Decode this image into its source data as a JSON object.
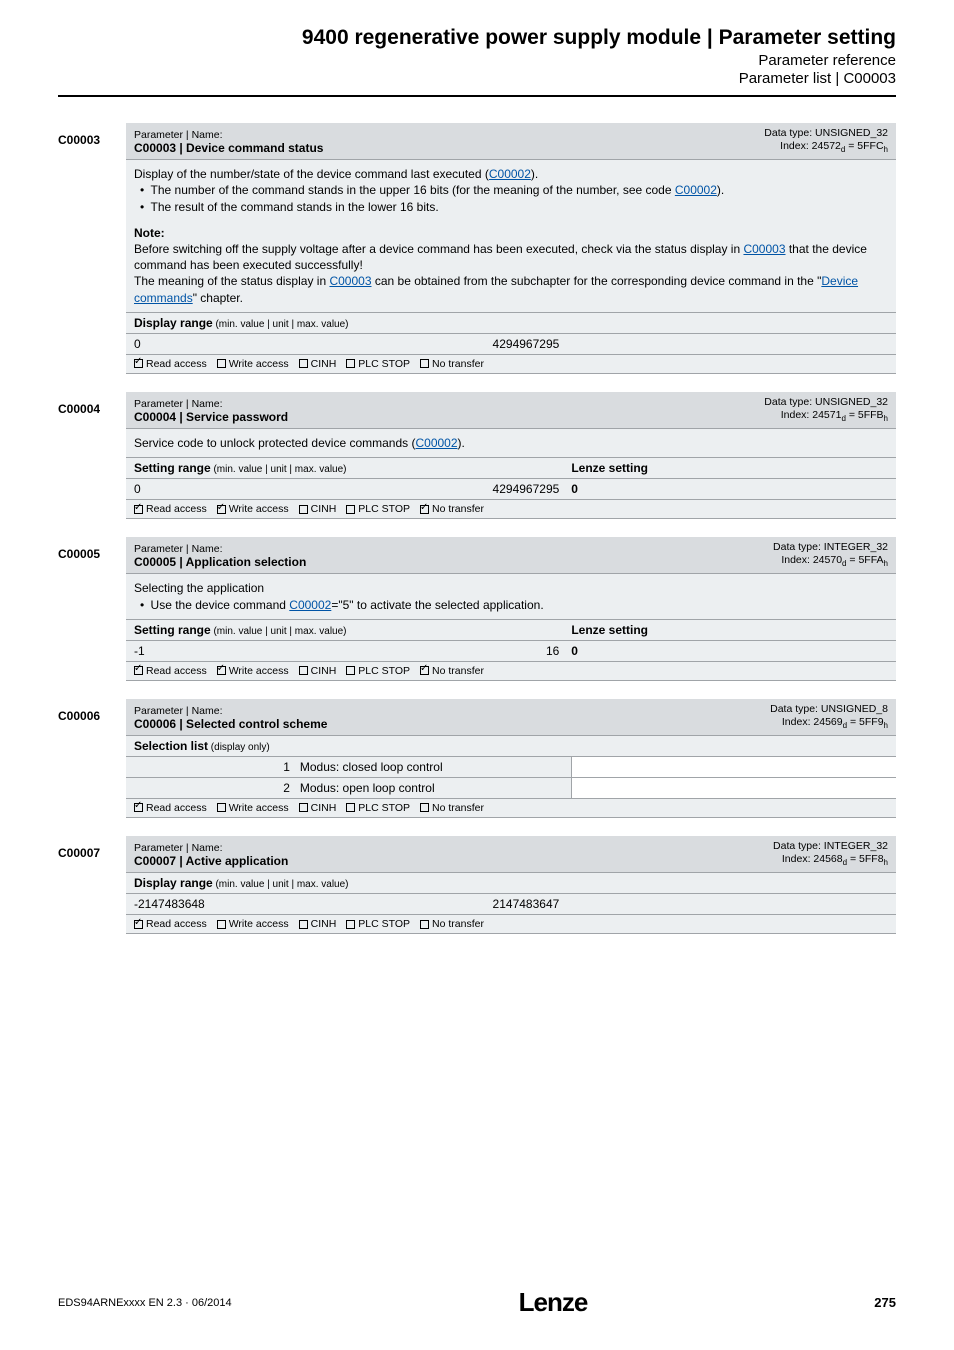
{
  "header": {
    "title": "9400 regenerative power supply module | Parameter setting",
    "sub1": "Parameter reference",
    "sub2": "Parameter list | C00003"
  },
  "params": [
    {
      "code": "C00003",
      "head": {
        "pn_label": "Parameter | Name:",
        "pn_name": "C00003 | Device command status",
        "dtype": "Data type: UNSIGNED_32",
        "index_pre": "Index: 24572",
        "index_sub1": "d",
        "index_mid": " = 5FFC",
        "index_sub2": "h"
      },
      "desc": {
        "line1_a": "Display of the number/state of the device command last executed (",
        "line1_link": "C00002",
        "line1_b": ").",
        "b1_a": "The number of the command stands in the upper 16 bits (for the meaning of the number, see code ",
        "b1_link": "C00002",
        "b1_b": ").",
        "b2": "The result of the command stands in the lower 16 bits.",
        "note_title": "Note:",
        "n1": "Before switching off the supply voltage after a device command has been executed, check via the status display in ",
        "n1_link": "C00003",
        "n1_b": " that the device command has been executed successfully!",
        "n2_a": "The meaning of the status display in ",
        "n2_link": "C00003",
        "n2_b": " can be obtained from the subchapter for the corresponding device command in the \"",
        "n2_link2": "Device commands",
        "n2_c": "\" chapter."
      },
      "dr_label": "Display range",
      "dr_hint": " (min. value | unit | max. value)",
      "val": {
        "min": "0",
        "mid": "",
        "max": "4294967295",
        "set": ""
      },
      "access": {
        "read": true,
        "write": false,
        "cinh": false,
        "plc": false,
        "notransfer": false
      }
    },
    {
      "code": "C00004",
      "head": {
        "pn_label": "Parameter | Name:",
        "pn_name": "C00004 | Service password",
        "dtype": "Data type: UNSIGNED_32",
        "index_pre": "Index: 24571",
        "index_sub1": "d",
        "index_mid": " = 5FFB",
        "index_sub2": "h"
      },
      "desc_simple_a": "Service code to unlock protected device commands (",
      "desc_simple_link": "C00002",
      "desc_simple_b": ").",
      "sr_label": "Setting range",
      "sr_hint": " (min. value | unit | max. value)",
      "ls_label": "Lenze setting",
      "val": {
        "min": "0",
        "mid": "",
        "max": "4294967295",
        "set": "0"
      },
      "access": {
        "read": true,
        "write": true,
        "cinh": false,
        "plc": false,
        "notransfer": true
      }
    },
    {
      "code": "C00005",
      "head": {
        "pn_label": "Parameter | Name:",
        "pn_name": "C00005 | Application selection",
        "dtype": "Data type: INTEGER_32",
        "index_pre": "Index: 24570",
        "index_sub1": "d",
        "index_mid": " = 5FFA",
        "index_sub2": "h"
      },
      "desc5_line1": "Selecting the application",
      "desc5_b1_a": "Use the device command ",
      "desc5_b1_link": "C00002",
      "desc5_b1_b": "=\"5\" to activate the selected application.",
      "sr_label": "Setting range",
      "sr_hint": " (min. value | unit | max. value)",
      "ls_label": "Lenze setting",
      "val": {
        "min": "-1",
        "mid": "",
        "max": "16",
        "set": "0"
      },
      "access": {
        "read": true,
        "write": true,
        "cinh": false,
        "plc": false,
        "notransfer": true
      }
    },
    {
      "code": "C00006",
      "head": {
        "pn_label": "Parameter | Name:",
        "pn_name": "C00006 | Selected control scheme",
        "dtype": "Data type: UNSIGNED_8",
        "index_pre": "Index: 24569",
        "index_sub1": "d",
        "index_mid": " = 5FF9",
        "index_sub2": "h"
      },
      "sl_label": "Selection list",
      "sl_hint": " (display only)",
      "sel": [
        {
          "n": "1",
          "t": "Modus: closed loop control"
        },
        {
          "n": "2",
          "t": "Modus: open loop control"
        }
      ],
      "access": {
        "read": true,
        "write": false,
        "cinh": false,
        "plc": false,
        "notransfer": false
      }
    },
    {
      "code": "C00007",
      "head": {
        "pn_label": "Parameter | Name:",
        "pn_name": "C00007 | Active application",
        "dtype": "Data type: INTEGER_32",
        "index_pre": "Index: 24568",
        "index_sub1": "d",
        "index_mid": " = 5FF8",
        "index_sub2": "h"
      },
      "dr_label": "Display range",
      "dr_hint": " (min. value | unit | max. value)",
      "val": {
        "min": "-2147483648",
        "mid": "",
        "max": "2147483647",
        "set": ""
      },
      "access": {
        "read": true,
        "write": false,
        "cinh": false,
        "plc": false,
        "notransfer": false
      }
    }
  ],
  "access_labels": {
    "read": "Read access",
    "write": "Write access",
    "cinh": "CINH",
    "plc": "PLC STOP",
    "notransfer": "No transfer"
  },
  "footer": {
    "doc": "EDS94ARNExxxx EN 2.3 · 06/2014",
    "logo": "Lenze",
    "page": "275"
  }
}
